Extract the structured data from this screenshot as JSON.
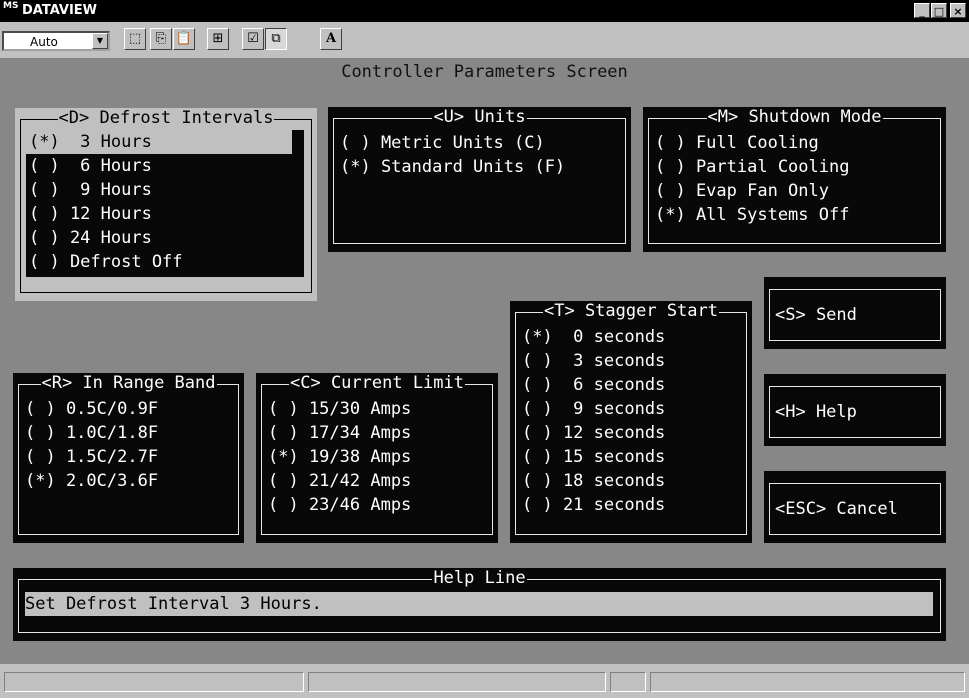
{
  "window": {
    "title": "DATAVIEW",
    "app_icon": "MS",
    "min_label": "_",
    "max_label": "□",
    "close_label": "×"
  },
  "toolbar": {
    "font_value": "Auto",
    "buttons": [
      "select-icon",
      "copy-icon",
      "paste-icon",
      "fullscreen-icon",
      "properties-icon",
      "background-icon",
      "font-icon"
    ],
    "font_button_label": "A"
  },
  "screen": {
    "title": "Controller Parameters Screen",
    "defrost": {
      "title": "<D> Defrost Intervals",
      "items": [
        "(*)  3 Hours",
        "( )  6 Hours",
        "( )  9 Hours",
        "( ) 12 Hours",
        "( ) 24 Hours",
        "( ) Defrost Off"
      ]
    },
    "units": {
      "title": "<U> Units",
      "items": [
        "( ) Metric Units (C)",
        "(*) Standard Units (F)"
      ]
    },
    "shutdown": {
      "title": "<M> Shutdown Mode",
      "items": [
        "( ) Full Cooling",
        "( ) Partial Cooling",
        "( ) Evap Fan Only",
        "(*) All Systems Off"
      ]
    },
    "range": {
      "title": "<R> In Range Band",
      "items": [
        "( ) 0.5C/0.9F",
        "( ) 1.0C/1.8F",
        "( ) 1.5C/2.7F",
        "(*) 2.0C/3.6F"
      ]
    },
    "current": {
      "title": "<C> Current Limit",
      "items": [
        "( ) 15/30 Amps",
        "( ) 17/34 Amps",
        "(*) 19/38 Amps",
        "( ) 21/42 Amps",
        "( ) 23/46 Amps"
      ]
    },
    "stagger": {
      "title": "<T> Stagger Start",
      "items": [
        "(*)  0 seconds",
        "( )  3 seconds",
        "( )  6 seconds",
        "( )  9 seconds",
        "( ) 12 seconds",
        "( ) 15 seconds",
        "( ) 18 seconds",
        "( ) 21 seconds"
      ]
    },
    "buttons": {
      "send": "<S> Send",
      "help": "<H> Help",
      "cancel": "<ESC> Cancel"
    },
    "helpline": {
      "title": "Help Line",
      "text": "Set Defrost Interval 3 Hours."
    }
  },
  "colors": {
    "screen_bg": "#878787",
    "panel_bg": "#080808",
    "highlight": "#c0c0c0",
    "text": "#ffffff"
  }
}
